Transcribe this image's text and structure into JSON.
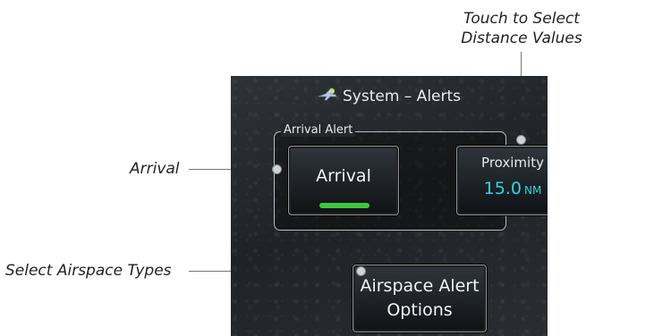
{
  "callouts": {
    "distance_line1": "Touch to Select",
    "distance_line2": "Distance Values",
    "arrival": "Arrival",
    "airspace": "Select Airspace Types"
  },
  "screen": {
    "title": "System – Alerts",
    "title_icon": "airplane-icon",
    "group_label": "Arrival Alert",
    "arrival_button": {
      "label": "Arrival",
      "enabled": true,
      "indicator_color": "#3ec63e"
    },
    "proximity_button": {
      "label": "Proximity",
      "value": "15.0",
      "unit": "NM",
      "value_color": "#2fd6e0"
    },
    "options_button": {
      "line1": "Airspace Alert",
      "line2": "Options"
    }
  }
}
